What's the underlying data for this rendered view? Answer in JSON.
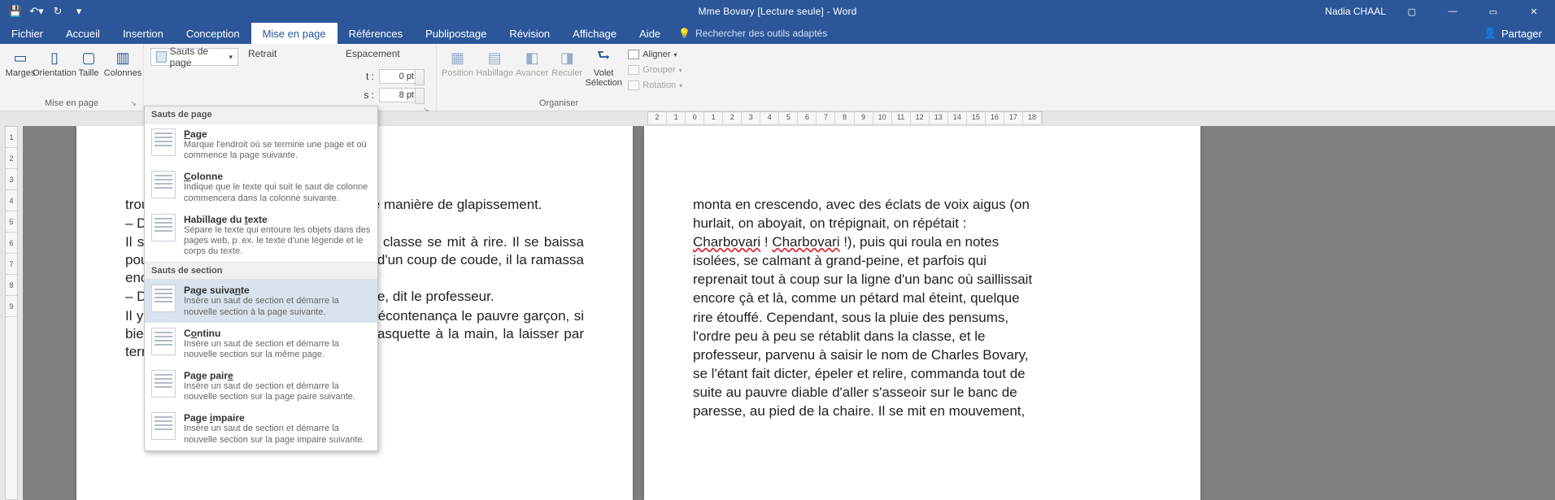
{
  "titlebar": {
    "app_title": "Mme Bovary [Lecture seule] - Word",
    "user": "Nadia CHAAL"
  },
  "tabs": {
    "items": [
      "Fichier",
      "Accueil",
      "Insertion",
      "Conception",
      "Mise en page",
      "Références",
      "Publipostage",
      "Révision",
      "Affichage",
      "Aide"
    ],
    "active_index": 4,
    "tell_me": "Rechercher des outils adaptés",
    "share": "Partager"
  },
  "ribbon": {
    "group_page_setup": {
      "label": "Mise en page",
      "buttons": [
        "Marges",
        "Orientation",
        "Taille",
        "Colonnes"
      ],
      "breaks_btn": "Sauts de page"
    },
    "retrait_label": "Retrait",
    "espacement_label": "Espacement",
    "espacement": {
      "before_label": "t :",
      "before_value": "0 pt",
      "after_label": "s :",
      "after_value": "8 pt"
    },
    "arrange": {
      "label": "Organiser",
      "position": "Position",
      "habillage": "Habillage",
      "avancer": "Avancer",
      "reculer": "Reculer",
      "volet": "Volet Sélection",
      "aligner": "Aligner",
      "grouper": "Grouper",
      "rotation": "Rotation"
    }
  },
  "dropdown": {
    "header1": "Sauts de page",
    "header2": "Sauts de section",
    "items_breaks": [
      {
        "title_pre": "",
        "title_u": "P",
        "title_post": "age",
        "desc": "Marque l'endroit où se termine une page et où commence la page suivante."
      },
      {
        "title_pre": "",
        "title_u": "C",
        "title_post": "olonne",
        "desc": "Indique que le texte qui suit le saut de colonne commencera dans la colonne suivante."
      },
      {
        "title_pre": "Habillage du ",
        "title_u": "t",
        "title_post": "exte",
        "desc": "Sépare le texte qui entoure les objets dans des pages web, p. ex. le texte d'une légende et le corps du texte."
      }
    ],
    "items_section": [
      {
        "title_pre": "Page suiva",
        "title_u": "n",
        "title_post": "te",
        "desc": "Insère un saut de section et démarre la nouvelle section à la page suivante.",
        "hover": true
      },
      {
        "title_pre": "C",
        "title_u": "o",
        "title_post": "ntinu",
        "desc": "Insère un saut de section et démarre la nouvelle section sur la même page."
      },
      {
        "title_pre": "Page pair",
        "title_u": "e",
        "title_post": "",
        "desc": "Insère un saut de section et démarre la nouvelle section sur la page paire suivante."
      },
      {
        "title_pre": "Page ",
        "title_u": "i",
        "title_post": "mpaire",
        "desc": "Insère un saut de section et démarre la nouvelle section sur la page impaire suivante."
      }
    ]
  },
  "ruler2": {
    "start": -2,
    "end": 18
  },
  "vruler": {
    "start": 1,
    "end": 9
  },
  "doc": {
    "page1_text": "trouva pas ; il la chercha, balbutiant d'une manière de glapissement.\n– Debout, répéta le professeur.\nIl se leva ; sa casquette tomba. Toute la classe se mit à rire. Il se baissa pour la reprendre. Un voisin la fit tomber d'un coup de coude, il la ramassa encore une fois.\n– Débarrassez-vous donc de votre casque, dit le professeur.\nIl y eut un rire éclatant des écoliers qui décontenança le pauvre garçon, si bien qu'il ne savait s'il fallait garder sa casquette à la main, la laisser par terre ou la mettre sur",
    "page2_lines": [
      "monta en crescendo, avec des éclats de voix aigus (on",
      "hurlait, on aboyait, on trépignait, on répétait :",
      {
        "pre": "",
        "w1": "Charbovari",
        "mid": " ! ",
        "w2": "Charbovari",
        "post": " !), puis qui roula en notes"
      },
      "isolées, se calmant à grand-peine, et parfois qui",
      "reprenait tout à coup sur la ligne d'un banc où saillissait",
      "encore çà et là, comme un pétard mal éteint, quelque",
      "rire étouffé. Cependant, sous la pluie des pensums,",
      "l'ordre peu à peu se rétablit dans la classe, et le",
      "professeur, parvenu à saisir le nom de Charles Bovary,",
      "se l'étant fait dicter, épeler et relire, commanda tout de",
      "suite au pauvre diable d'aller s'asseoir sur le banc de",
      "paresse, au pied de la chaire. Il se mit en mouvement,"
    ]
  }
}
